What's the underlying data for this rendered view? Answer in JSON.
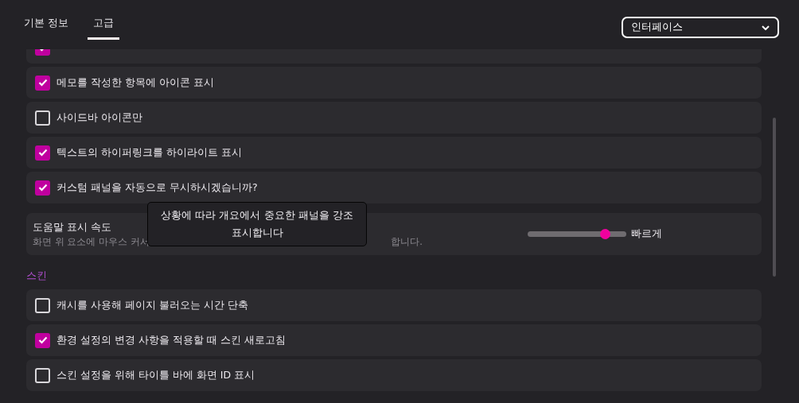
{
  "tabs": [
    {
      "label": "기본 정보",
      "selected": false
    },
    {
      "label": "고급",
      "selected": true
    }
  ],
  "category_dropdown": {
    "value": "인터페이스"
  },
  "settings": [
    {
      "kind": "checkbox",
      "checked": true
    },
    {
      "kind": "checkbox",
      "label": "메모를 작성한 항목에 아이콘 표시",
      "checked": true
    },
    {
      "kind": "checkbox",
      "label": "사이드바 아이콘만",
      "checked": false
    },
    {
      "kind": "checkbox",
      "label": "텍스트의 하이퍼링크를 하이라이트 표시",
      "checked": true
    },
    {
      "kind": "checkbox",
      "label": "커스텀 패널을 자동으로 무시하시겠습니까?",
      "checked": true
    },
    {
      "kind": "slider",
      "label": "도움말 표시 속도",
      "description_parts": [
        "화면 위 요소에 마우스 커서",
        "합니다."
      ],
      "level": 0.78,
      "value_label": "빠르게"
    },
    {
      "kind": "section",
      "label": "스킨"
    },
    {
      "kind": "checkbox",
      "label": "캐시를 사용해 페이지 불러오는 시간 단축",
      "checked": false
    },
    {
      "kind": "checkbox",
      "label": "환경 설정의 변경 사항을 적용할 때 스킨 새로고침",
      "checked": true
    },
    {
      "kind": "checkbox",
      "label": "스킨 설정을 위해 타이틀 바에 화면 ID 표시",
      "checked": false
    }
  ],
  "tooltip": {
    "text": "상황에 따라 개요에서 중요한 패널을 강조 표시합니다"
  }
}
